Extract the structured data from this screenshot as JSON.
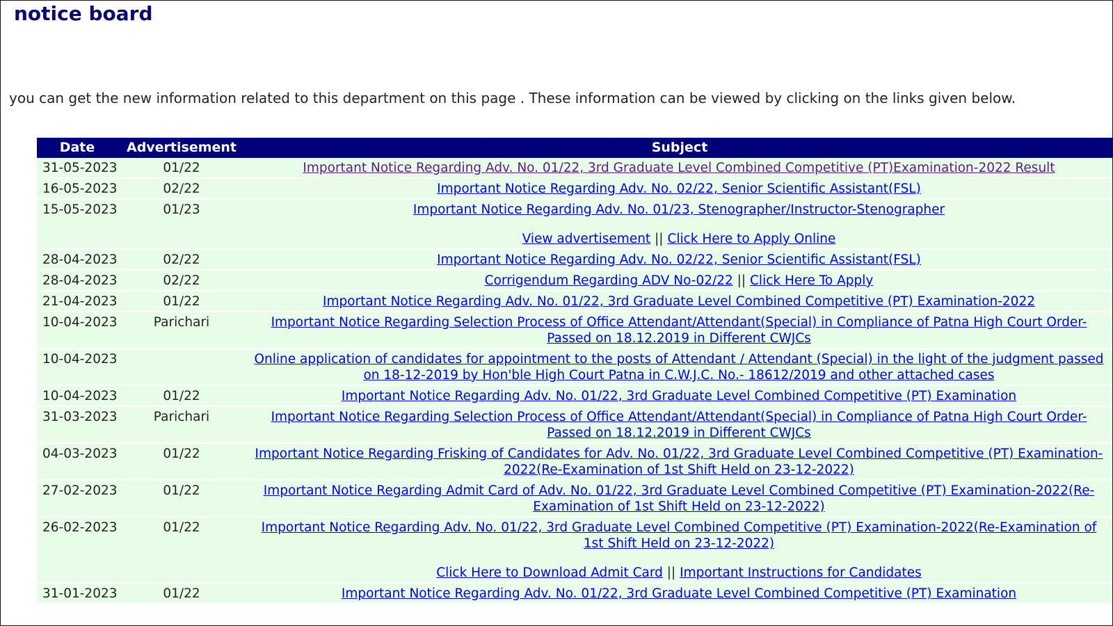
{
  "page": {
    "title": "notice board",
    "intro": "you can get the new information related to this department on this page . These information can be viewed by clicking on the links given below."
  },
  "table": {
    "headers": {
      "date": "Date",
      "adv": "Advertisement",
      "subject": "Subject"
    },
    "rows": [
      {
        "date": "31-05-2023",
        "adv": "01/22",
        "link1": "Important Notice Regarding Adv. No. 01/22, 3rd Graduate Level Combined Competitive (PT)Examination-2022 Result"
      },
      {
        "date": "16-05-2023",
        "adv": "02/22",
        "link1": "Important Notice Regarding Adv. No. 02/22, Senior Scientific Assistant(FSL)"
      },
      {
        "date": "15-05-2023",
        "adv": "01/23",
        "link1": "Important Notice Regarding Adv. No. 01/23, Stenographer/Instructor-Stenographer",
        "link2": "View advertisement",
        "sep": "||",
        "link3": "Click Here to Apply Online"
      },
      {
        "date": "28-04-2023",
        "adv": "02/22",
        "link1": "Important Notice Regarding Adv. No. 02/22, Senior Scientific Assistant(FSL)"
      },
      {
        "date": "28-04-2023",
        "adv": "02/22",
        "link1": "Corrigendum Regarding ADV No-02/22",
        "sep": "||",
        "link2": "Click Here To Apply"
      },
      {
        "date": "21-04-2023",
        "adv": "01/22",
        "link1": "Important Notice Regarding Adv. No. 01/22, 3rd Graduate Level Combined Competitive (PT) Examination-2022"
      },
      {
        "date": "10-04-2023",
        "adv": "Parichari",
        "link1": "Important Notice Regarding Selection Process of Office Attendant/Attendant(Special) in Compliance of Patna High Court Order- Passed on 18.12.2019 in Different CWJCs"
      },
      {
        "date": "10-04-2023",
        "adv": "",
        "link1": "Online application of candidates for appointment to the posts of Attendant / Attendant (Special) in the light of the judgment passed on 18-12-2019 by Hon'ble High Court Patna in C.W.J.C. No.- 18612/2019 and other attached cases"
      },
      {
        "date": "10-04-2023",
        "adv": "01/22",
        "link1": "Important Notice Regarding Adv. No. 01/22, 3rd Graduate Level Combined Competitive (PT) Examination"
      },
      {
        "date": "31-03-2023",
        "adv": "Parichari",
        "link1": "Important Notice Regarding Selection Process of Office Attendant/Attendant(Special) in Compliance of Patna High Court Order- Passed on 18.12.2019 in Different CWJCs"
      },
      {
        "date": "04-03-2023",
        "adv": "01/22",
        "link1": "Important Notice Regarding Frisking of Candidates for Adv. No. 01/22, 3rd Graduate Level Combined Competitive (PT) Examination-2022(Re-Examination of 1st Shift Held on 23-12-2022)"
      },
      {
        "date": "27-02-2023",
        "adv": "01/22",
        "link1": "Important Notice Regarding Admit Card of Adv. No. 01/22, 3rd Graduate Level Combined Competitive (PT) Examination-2022(Re-Examination of 1st Shift Held on 23-12-2022)"
      },
      {
        "date": "26-02-2023",
        "adv": "01/22",
        "link1": "Important Notice Regarding Adv. No. 01/22, 3rd Graduate Level Combined Competitive (PT) Examination-2022(Re-Examination of 1st Shift Held on 23-12-2022)",
        "link2": "Click Here to Download Admit Card",
        "sep": "||",
        "link3": "Important Instructions for Candidates"
      },
      {
        "date": "31-01-2023",
        "adv": "01/22",
        "link1": "Important Notice Regarding Adv. No. 01/22, 3rd Graduate Level Combined Competitive (PT) Examination"
      }
    ]
  },
  "colors": {
    "title": "#0b0b6e",
    "header_bg": "#00007a",
    "row_bg": "#e8fde8",
    "link": "#0000ee",
    "visited_link": "#5a1a8b"
  }
}
